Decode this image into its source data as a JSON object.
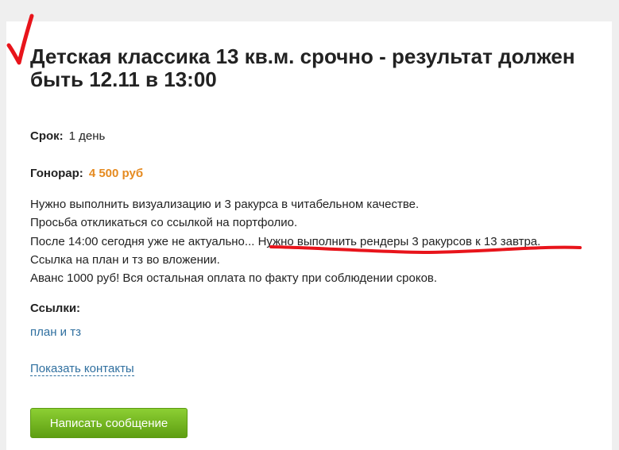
{
  "project": {
    "title": "Детская классика 13 кв.м. срочно - результат должен быть 12.11 в 13:00",
    "deadline_label": "Срок:",
    "deadline_value": "1 день",
    "fee_label": "Гонорар:",
    "fee_value": "4 500 руб",
    "fee_color": "#e58a1f",
    "description": [
      "Нужно выполнить визуализацию и 3 ракурса в читабельном качестве.",
      "Просьба откликаться со ссылкой на портфолио.",
      "После 14:00 сегодня уже не актуально... Нужно выполнить рендеры 3 ракурсов к 13 завтра.",
      "Ссылка на план и тз во вложении.",
      "Аванс 1000 руб! Вся остальная оплата по факту при соблюдении сроков."
    ],
    "links_label": "Ссылки:",
    "links": [
      "план и тз"
    ]
  },
  "actions": {
    "show_contacts": "Показать контакты",
    "send_message": "Написать сообщение",
    "button_color": "#6aad1b"
  },
  "annotations": {
    "check_mark": "red-checkmark",
    "underline": "red-underline",
    "color": "#e8141b"
  }
}
